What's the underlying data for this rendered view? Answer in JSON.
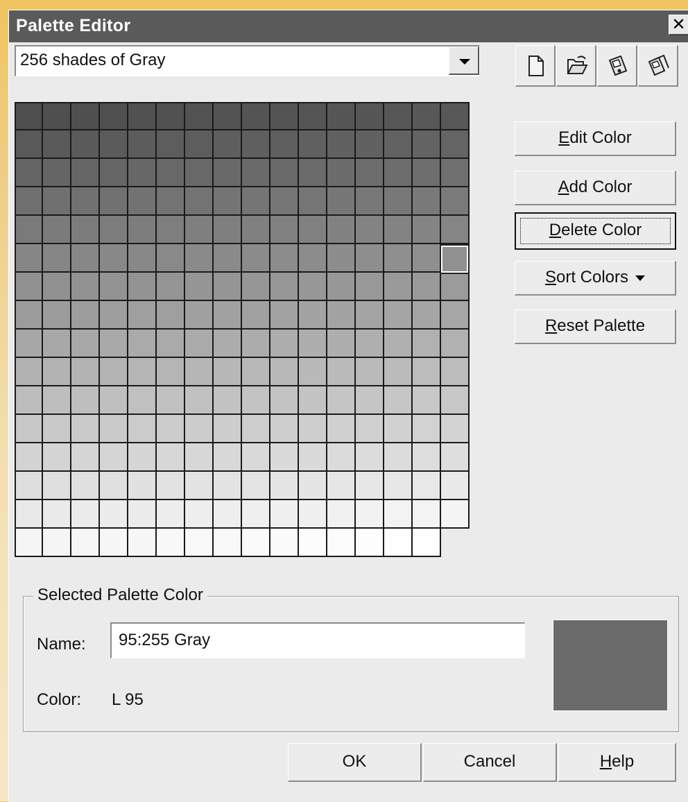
{
  "window": {
    "title": "Palette Editor",
    "close_glyph": "✕"
  },
  "palette_select": {
    "value": "256 shades of Gray"
  },
  "file_toolbar": {
    "icons": [
      "new-palette-icon",
      "open-palette-icon",
      "save-palette-icon",
      "save-as-palette-icon"
    ]
  },
  "swatches": {
    "count": 256,
    "selected_index": 95,
    "background_color": "#ebebeb"
  },
  "side_buttons": {
    "edit": {
      "pre": "",
      "mn": "E",
      "post": "dit Color"
    },
    "add": {
      "pre": "",
      "mn": "A",
      "post": "dd Color"
    },
    "delete": {
      "pre": "",
      "mn": "D",
      "post": "elete Color"
    },
    "sort": {
      "pre": "",
      "mn": "S",
      "post": "ort Colors"
    },
    "reset": {
      "pre": "",
      "mn": "R",
      "post": "eset Palette"
    }
  },
  "selected_color": {
    "group_label": "Selected Palette Color",
    "name_label": "Name:",
    "name_value": "95:255  Gray",
    "color_label": "Color:",
    "color_value": "L  95",
    "preview_color": "#6b6b6b"
  },
  "footer": {
    "ok_label": "OK",
    "cancel_label": "Cancel",
    "help": {
      "pre": "",
      "mn": "H",
      "post": "elp"
    }
  }
}
